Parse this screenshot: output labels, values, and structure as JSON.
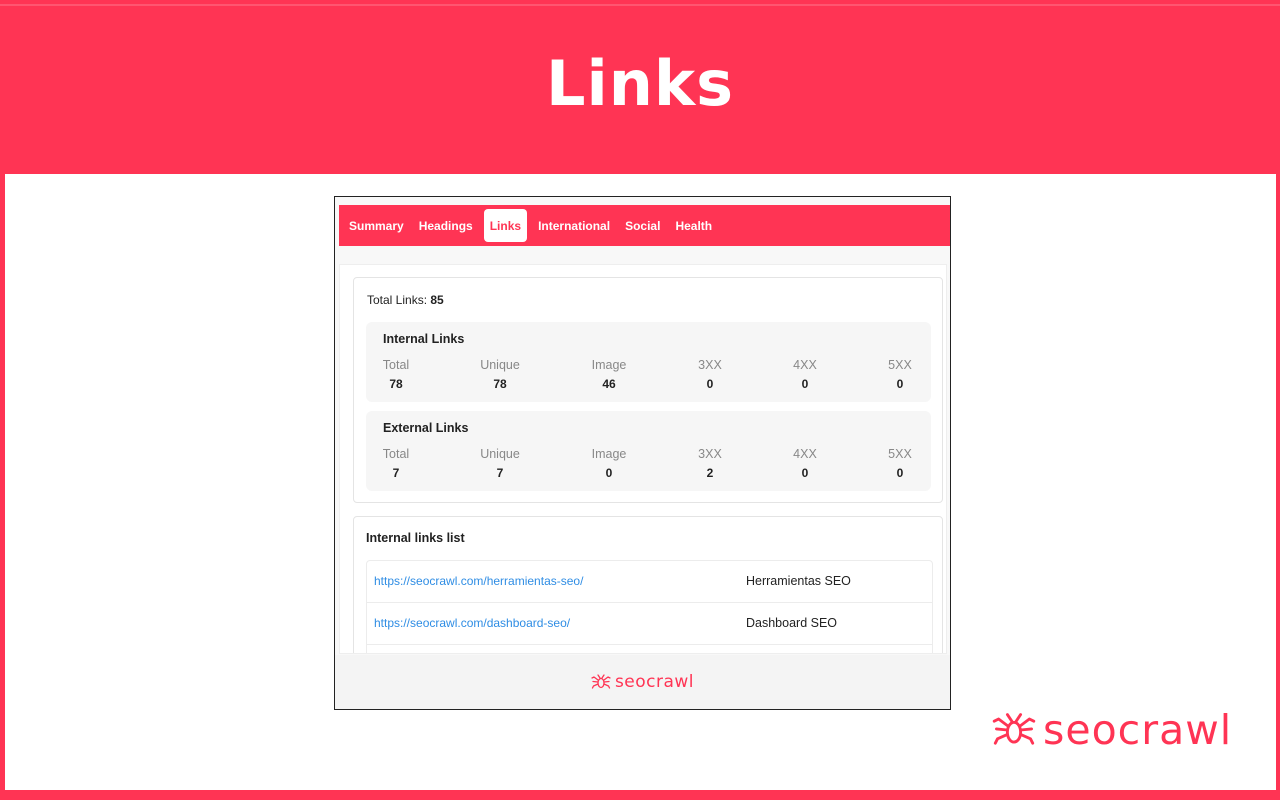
{
  "page": {
    "title": "Links"
  },
  "tabs": [
    {
      "label": "Summary",
      "active": false
    },
    {
      "label": "Headings",
      "active": false
    },
    {
      "label": "Links",
      "active": true
    },
    {
      "label": "International",
      "active": false
    },
    {
      "label": "Social",
      "active": false
    },
    {
      "label": "Health",
      "active": false
    }
  ],
  "summary": {
    "total_label": "Total Links:",
    "total_value": "85",
    "internal": {
      "title": "Internal Links",
      "stats": [
        {
          "label": "Total",
          "value": "78"
        },
        {
          "label": "Unique",
          "value": "78"
        },
        {
          "label": "Image",
          "value": "46"
        },
        {
          "label": "3XX",
          "value": "0"
        },
        {
          "label": "4XX",
          "value": "0"
        },
        {
          "label": "5XX",
          "value": "0"
        }
      ]
    },
    "external": {
      "title": "External Links",
      "stats": [
        {
          "label": "Total",
          "value": "7"
        },
        {
          "label": "Unique",
          "value": "7"
        },
        {
          "label": "Image",
          "value": "0"
        },
        {
          "label": "3XX",
          "value": "2"
        },
        {
          "label": "4XX",
          "value": "0"
        },
        {
          "label": "5XX",
          "value": "0"
        }
      ]
    }
  },
  "internal_list": {
    "title": "Internal links list",
    "rows": [
      {
        "url": "https://seocrawl.com/herramientas-seo/",
        "anchor": "Herramientas SEO"
      },
      {
        "url": "https://seocrawl.com/dashboard-seo/",
        "anchor": "Dashboard SEO"
      },
      {
        "url": "",
        "anchor": ""
      }
    ]
  },
  "footer": {
    "brand": "seocrawl",
    "icon": "spider-icon"
  },
  "brand": {
    "name": "seocrawl",
    "icon": "spider-icon"
  },
  "colors": {
    "accent": "#ff3454",
    "link": "#2f8de4"
  }
}
